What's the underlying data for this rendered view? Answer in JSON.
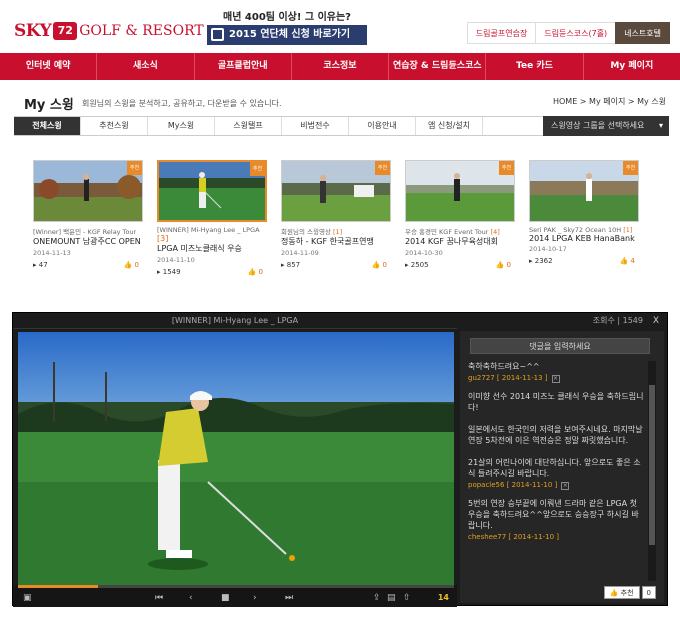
{
  "header": {
    "logo": {
      "sky": "SKY",
      "badge": "72",
      "rest": "GOLF & RESORT"
    },
    "promo": {
      "line1": "매년 400팀 이상! 그 이유는?",
      "line2": "2015 연단체 신청 바로가기"
    },
    "links": [
      {
        "label": "드림골프연습장"
      },
      {
        "label": "드림듄스코스(7홀)"
      },
      {
        "label": "네스트호텔"
      }
    ]
  },
  "nav": [
    {
      "label": "인터넷 예약"
    },
    {
      "label": "새소식"
    },
    {
      "label": "골프클럽안내"
    },
    {
      "label": "코스정보"
    },
    {
      "label": "연습장 & 드림듄스코스"
    },
    {
      "label": "Tee 카드"
    },
    {
      "label": "My 페이지"
    }
  ],
  "page": {
    "title": "My 스윙",
    "desc": "회원님의 스윙을 분석하고, 공유하고, 다운받을 수 있습니다.",
    "breadcrumb": "HOME > My 페이지 > My 스윙"
  },
  "tabs": [
    {
      "label": "전체스윙"
    },
    {
      "label": "추천스윙"
    },
    {
      "label": "My스윙"
    },
    {
      "label": "스윙탤프"
    },
    {
      "label": "비법전수"
    },
    {
      "label": "이용안내"
    },
    {
      "label": "앱 신청/설치"
    }
  ],
  "tab_select": "스윙영상 그룹을 선택하세요",
  "thumbs": [
    {
      "rec": "추천",
      "t1": "[Winner] 백윤민 - KGF Relay Tour",
      "t2": "ONEMOUNT 남광주CC OPEN",
      "cnt": "",
      "date": "2014-11-13",
      "views": "47",
      "likes": "0"
    },
    {
      "rec": "추천",
      "t1": "[WINNER] Mi-Hyang Lee _ LPGA",
      "cnt": "[3]",
      "t2": "LPGA 미즈노클래식 우승",
      "date": "2014-11-10",
      "views": "1549",
      "likes": "0"
    },
    {
      "rec": "추천",
      "t1": "회원님의 스윙영상",
      "cnt": "[1]",
      "t2": "정동하 - KGF 한국골프연맹",
      "date": "2014-11-09",
      "views": "857",
      "likes": "0"
    },
    {
      "rec": "추천",
      "t1": "우승 홍경민 KGF Event Tour",
      "cnt": "[4]",
      "t2": "2014 KGF 꿈나무육성대회",
      "date": "2014-10-30",
      "views": "2505",
      "likes": "0"
    },
    {
      "rec": "추천",
      "t1": "Seri PAK _ Sky72 Ocean 10H",
      "cnt": "[1]",
      "t2": "2014 LPGA KEB HanaBank",
      "date": "2014-10-17",
      "views": "2362",
      "likes": "4"
    }
  ],
  "player": {
    "title": "[WINNER] Mi-Hyang Lee _ LPGA",
    "views": "조회수 | 1549",
    "close": "X",
    "counter": "14",
    "comment_button": "댓글을 입력하세요",
    "like_label": "추천",
    "like_count": "0",
    "comments": [
      {
        "body": "축하축하드려요~^^",
        "meta": "gu2727 [ 2014-11-13 ]"
      },
      {
        "body": "이미향 선수 2014 미즈노 클래식 우승을 축하드립니다!\n\n일본에서도 한국인의 저력을 보여주시네요. 마지막날 연장 5차전에 이은 역전승은 정말 짜릿했습니다.\n\n21살의 어린나이에 대단하십니다. 앞으로도 좋은 소식 들려주시길 바랍니다.",
        "meta": "popacle56 [ 2014-11-10 ]"
      },
      {
        "body": "5번의 연장 승부끝에 이뤄낸 드라마 같은 LPGA 첫 우승을 축하드려요^^앞으로도 승승장구 하시길 바랍니다.",
        "meta": "cheshee77 [ 2014-11-10 ]"
      }
    ]
  }
}
